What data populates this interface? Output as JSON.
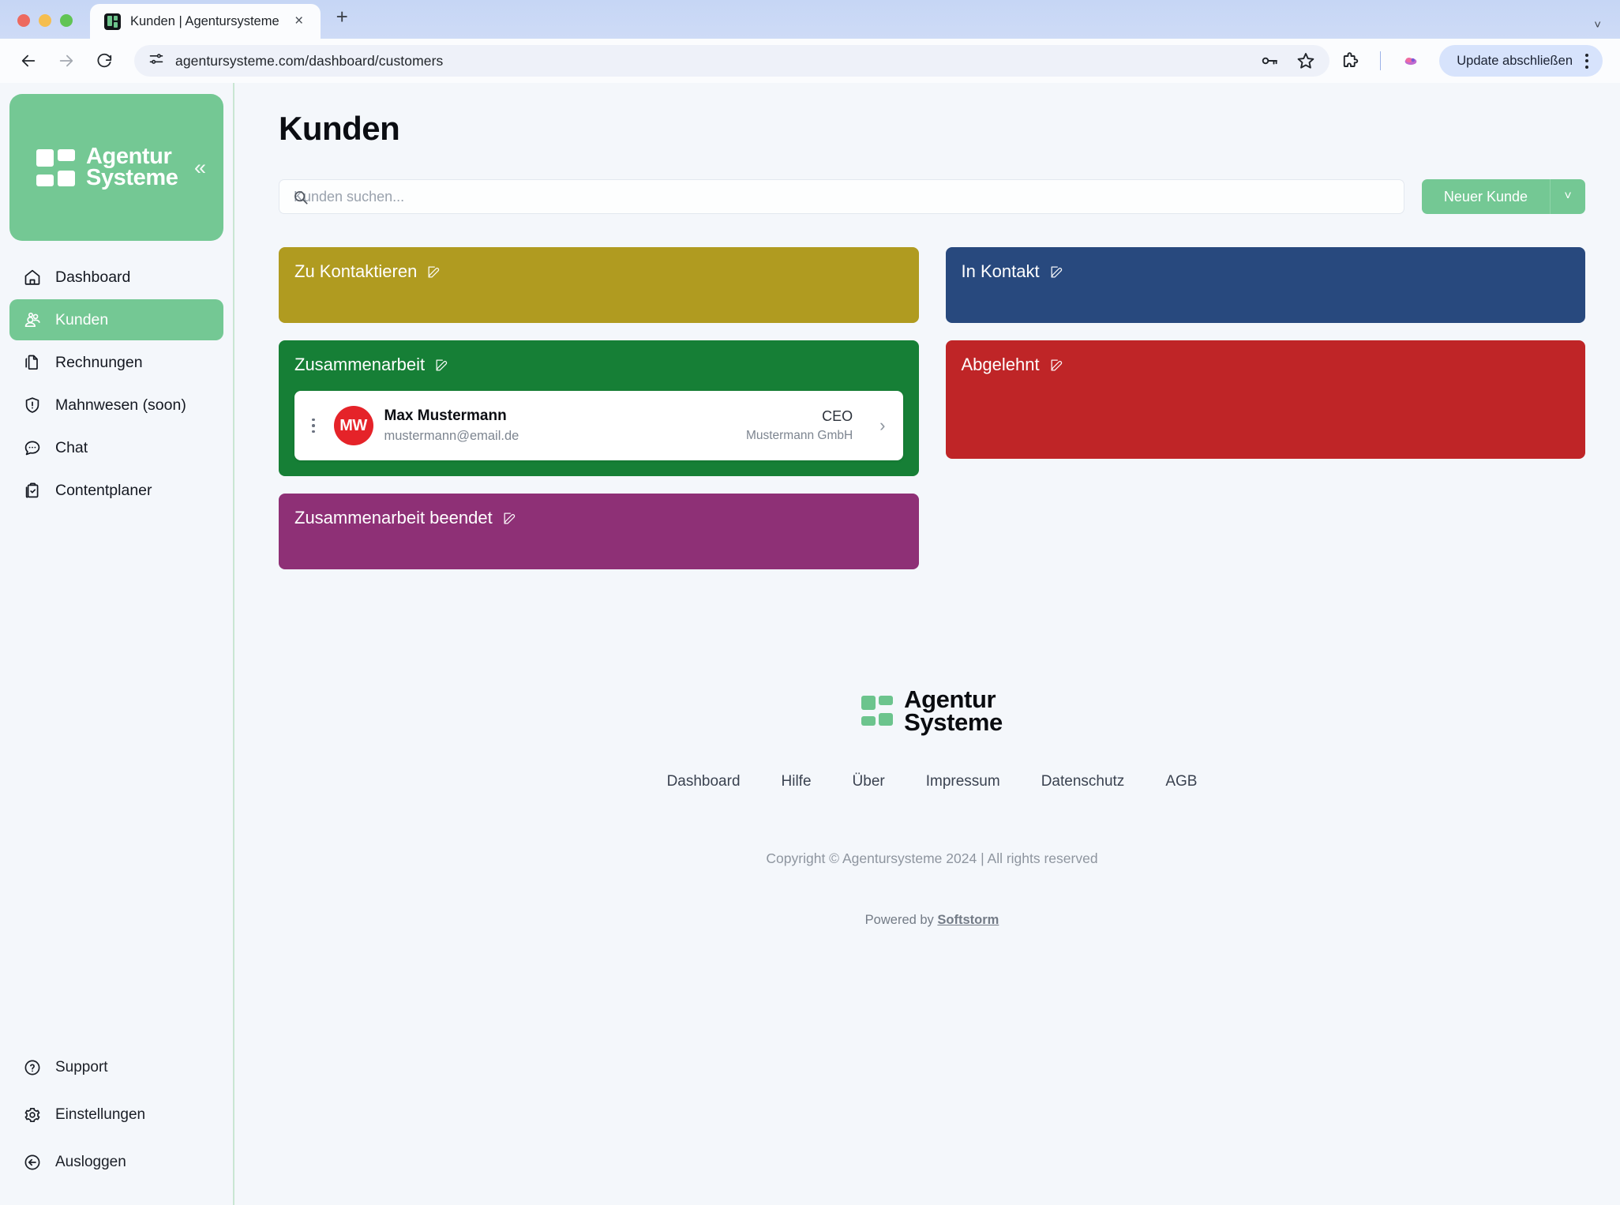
{
  "browser": {
    "tab": {
      "title": "Kunden | Agentursysteme",
      "favicon": "agentursysteme-favicon",
      "close": "×"
    },
    "new_tab": "+",
    "window_chevron": "˅",
    "url": "agentursysteme.com/dashboard/customers",
    "update_button": "Update abschließen"
  },
  "sidebar": {
    "logo": {
      "line1": "Agentur",
      "line2": "Systeme"
    },
    "collapse": "«",
    "items": [
      {
        "label": "Dashboard",
        "icon": "home-icon"
      },
      {
        "label": "Kunden",
        "icon": "users-icon"
      },
      {
        "label": "Rechnungen",
        "icon": "documents-icon"
      },
      {
        "label": "Mahnwesen (soon)",
        "icon": "shield-alert-icon"
      },
      {
        "label": "Chat",
        "icon": "chat-bubble-icon"
      },
      {
        "label": "Contentplaner",
        "icon": "clipboard-check-icon"
      }
    ],
    "bottom_items": [
      {
        "label": "Support",
        "icon": "help-circle-icon"
      },
      {
        "label": "Einstellungen",
        "icon": "gear-icon"
      },
      {
        "label": "Ausloggen",
        "icon": "logout-icon"
      }
    ]
  },
  "main": {
    "page_title": "Kunden",
    "search": {
      "value": "",
      "placeholder": "Kunden suchen..."
    },
    "new_customer": {
      "label": "Neuer Kunde",
      "caret": "˅"
    },
    "columns": [
      [
        {
          "title": "Zu Kontaktieren",
          "color": "#b09b20",
          "customers": []
        },
        {
          "title": "Zusammenarbeit",
          "color": "#167f36",
          "customers": [
            {
              "initials": "MW",
              "avatar_color": "#e52329",
              "name": "Max Mustermann",
              "email": "mustermann@email.de",
              "role": "CEO",
              "company": "Mustermann GmbH",
              "chevron": "›"
            }
          ]
        },
        {
          "title": "Zusammenarbeit beendet",
          "color": "#8e3076",
          "customers": []
        }
      ],
      [
        {
          "title": "In Kontakt",
          "color": "#28497e",
          "customers": []
        },
        {
          "title": "Abgelehnt",
          "color": "#bf2527",
          "customers": []
        }
      ]
    ]
  },
  "footer": {
    "logo": {
      "line1": "Agentur",
      "line2": "Systeme"
    },
    "links": [
      "Dashboard",
      "Hilfe",
      "Über",
      "Impressum",
      "Datenschutz",
      "AGB"
    ],
    "copyright": "Copyright © Agentursysteme 2024 | All rights reserved",
    "powered_prefix": "Powered by ",
    "powered_link": "Softstorm"
  },
  "colors": {
    "brand_green": "#74c894",
    "page_bg": "#f4f7fb"
  }
}
